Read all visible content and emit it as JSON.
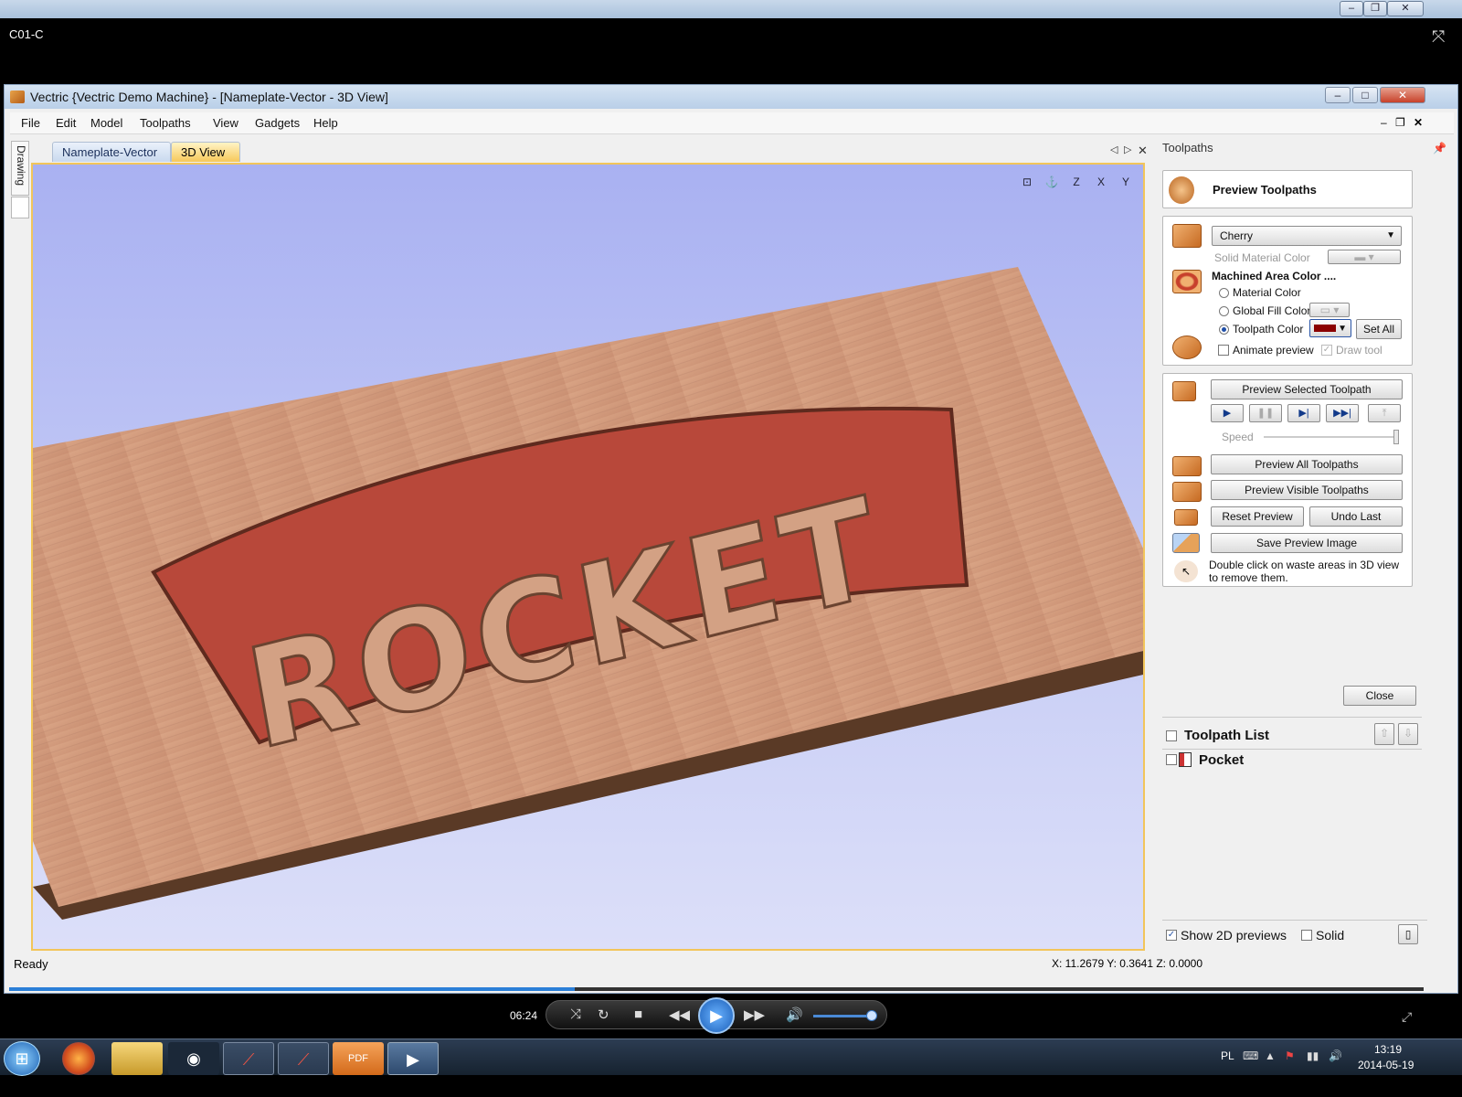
{
  "outer": {
    "title_blur": "",
    "clip_title": "C01-C"
  },
  "app": {
    "title": "Vectric {Vectric Demo Machine} - [Nameplate-Vector - 3D View]",
    "menu": [
      "File",
      "Edit",
      "Model",
      "Toolpaths",
      "View",
      "Gadgets",
      "Help"
    ],
    "side_tab": "Drawing",
    "tabs": [
      "Nameplate-Vector",
      "3D View"
    ],
    "active_tab": "3D View",
    "view_icons": [
      "zoom-fit-icon",
      "iso-view-icon",
      "z-view-icon",
      "x-view-icon",
      "y-view-icon"
    ],
    "view_labels": [
      "Z",
      "X",
      "Y"
    ],
    "sign_text": "ROCKET"
  },
  "panel": {
    "title": "Toolpaths",
    "preview_title": "Preview Toolpaths",
    "material_select": "Cherry",
    "solid_material_color": "Solid Material Color",
    "machined_area_color": "Machined Area Color ....",
    "radio_material": "Material Color",
    "radio_global": "Global Fill Color",
    "radio_toolpath": "Toolpath Color",
    "selected_radio": "Toolpath Color",
    "toolpath_color": "#8b0000",
    "set_all": "Set All",
    "animate_preview": "Animate preview",
    "draw_tool": "Draw tool",
    "animate_preview_checked": false,
    "draw_tool_checked": true,
    "preview_selected": "Preview Selected Toolpath",
    "speed_label": "Speed",
    "speed_level": 1.0,
    "preview_all": "Preview All Toolpaths",
    "preview_visible": "Preview Visible Toolpaths",
    "reset_preview": "Reset Preview",
    "undo_last": "Undo Last",
    "save_preview_image": "Save Preview Image",
    "hint": "Double click on waste areas in 3D view",
    "hint2": "to remove them.",
    "close": "Close",
    "toolpath_list_title": "Toolpath List",
    "toolpaths": [
      "Pocket"
    ],
    "show_2d_previews": "Show 2D previews",
    "show_2d_previews_checked": true,
    "solid": "Solid",
    "solid_checked": false
  },
  "status": {
    "text": "Ready",
    "coords": "X: 11.2679 Y: 0.3641 Z: 0.0000"
  },
  "player": {
    "time": "06:24",
    "progress": 0.4,
    "volume": 0.95
  },
  "taskbar": {
    "lang": "PL",
    "time": "13:19",
    "date": "2014-05-19"
  },
  "colors": {
    "viewport_sky": "#b3b9f3",
    "wood": "#d69a78",
    "pocket": "#b8483a",
    "accent_tab": "#f6c85a"
  }
}
